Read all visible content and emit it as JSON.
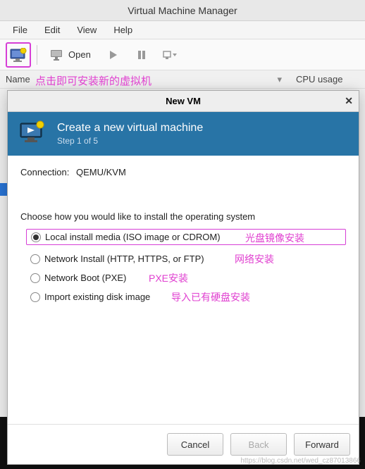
{
  "window": {
    "title": "Virtual Machine Manager"
  },
  "menu": {
    "file": "File",
    "edit": "Edit",
    "view": "View",
    "help": "Help"
  },
  "toolbar": {
    "open_label": "Open"
  },
  "columns": {
    "name": "Name",
    "arrow": "▾",
    "cpu": "CPU usage"
  },
  "annotations": {
    "new_vm": "点击即可安装新的虚拟机",
    "opt1": "光盘镜像安装",
    "opt2": "网络安装",
    "opt3": "PXE安装",
    "opt4": "导入已有硬盘安装"
  },
  "dialog": {
    "title": "New VM",
    "close": "✕",
    "header_title": "Create a new virtual machine",
    "step": "Step 1 of 5",
    "conn_label": "Connection:",
    "conn_value": "QEMU/KVM",
    "choose_label": "Choose how you would like to install the operating system",
    "options": {
      "local": "Local install media (ISO image or CDROM)",
      "network_install": "Network Install (HTTP, HTTPS, or FTP)",
      "network_boot": "Network Boot (PXE)",
      "import": "Import existing disk image"
    },
    "buttons": {
      "cancel": "Cancel",
      "back": "Back",
      "forward": "Forward"
    }
  },
  "watermark": "https://blog.csdn.net/wed_cz87013866"
}
